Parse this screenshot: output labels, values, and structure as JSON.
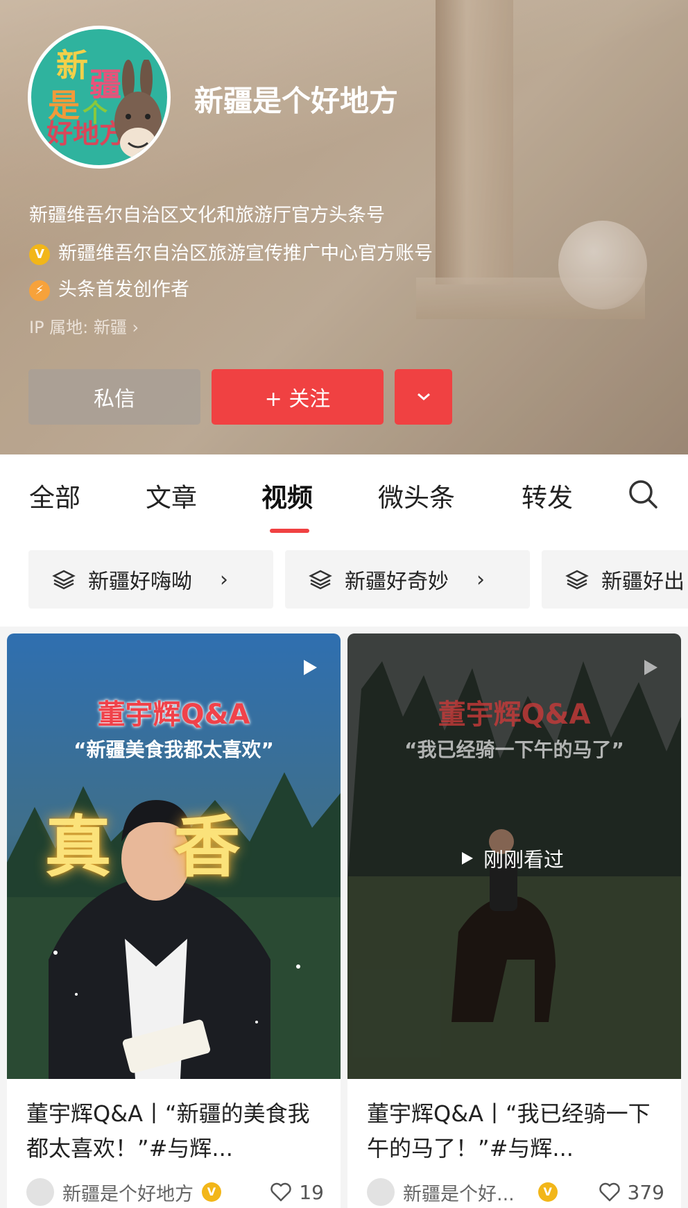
{
  "profile": {
    "name": "新疆是个好地方",
    "description": "新疆维吾尔自治区文化和旅游厅官方头条号",
    "verified_label": "新疆维吾尔自治区旅游宣传推广中心官方账号",
    "creator_label": "头条首发创作者",
    "ip_location": "IP 属地: 新疆 ",
    "avatar_text": [
      "新",
      "疆",
      "是",
      "个",
      "好地方"
    ]
  },
  "actions": {
    "message_label": "私信",
    "follow_label": "+ 关注"
  },
  "tabs": [
    {
      "label": "全部"
    },
    {
      "label": "文章"
    },
    {
      "label": "视频",
      "active": true
    },
    {
      "label": "微头条"
    },
    {
      "label": "转发"
    }
  ],
  "collections": [
    {
      "label": "新疆好嗨呦"
    },
    {
      "label": "新疆好奇妙"
    },
    {
      "label": "新疆好出"
    }
  ],
  "videos": [
    {
      "overlay_title": "董宇辉Q&A",
      "overlay_quote": "“新疆美食我都太喜欢”",
      "overlay_big": "真香",
      "title": "董宇辉Q&A丨“新疆的美食我都太喜欢！”#与辉...",
      "author": "新疆是个好地方",
      "likes": "19"
    },
    {
      "overlay_title": "董宇辉Q&A",
      "overlay_quote": "“我已经骑一下午的马了”",
      "watched_label": "刚刚看过",
      "title": "董宇辉Q&A丨“我已经骑一下午的马了！”#与辉...",
      "author": "新疆是个好...",
      "likes": "379"
    }
  ],
  "colors": {
    "accent": "#f04142",
    "verified_badge": "#f2b619",
    "creator_badge": "#f7a23b"
  }
}
